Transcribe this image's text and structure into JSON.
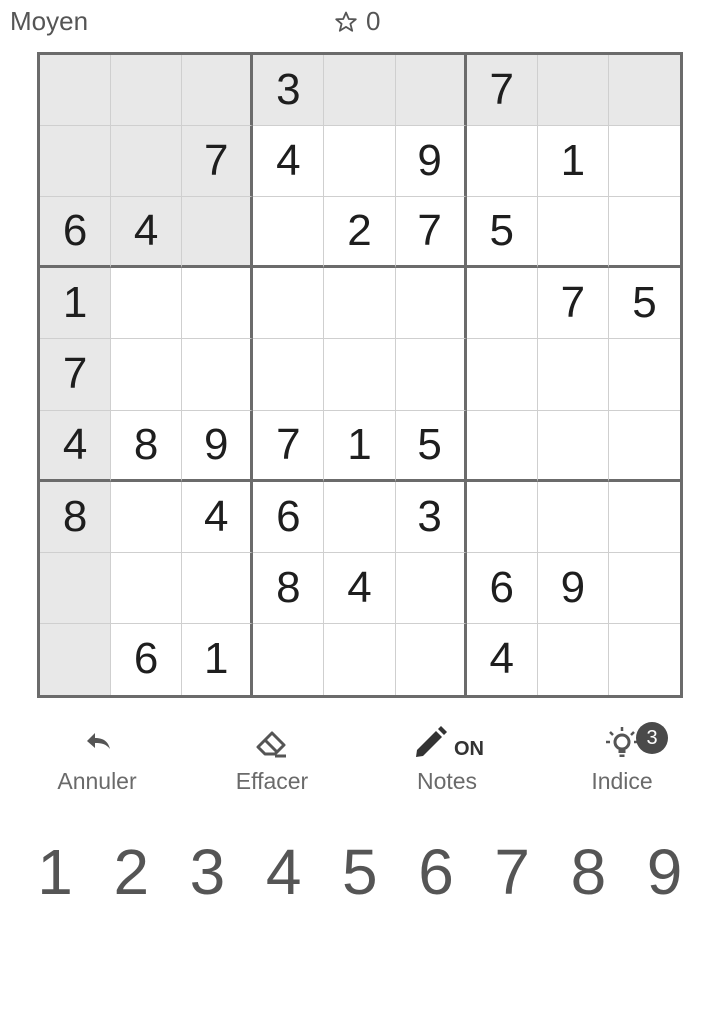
{
  "header": {
    "difficulty": "Moyen",
    "score": "0",
    "score_icon": "star-outline-icon"
  },
  "board": [
    [
      "",
      "",
      "",
      "3",
      "",
      "",
      "7",
      "",
      ""
    ],
    [
      "",
      "",
      "7",
      "4",
      "",
      "9",
      "",
      "1",
      ""
    ],
    [
      "6",
      "4",
      "",
      "",
      "2",
      "7",
      "5",
      "",
      ""
    ],
    [
      "1",
      "",
      "",
      "",
      "",
      "",
      "",
      "7",
      "5"
    ],
    [
      "7",
      "",
      "",
      "",
      "",
      "",
      "",
      "",
      ""
    ],
    [
      "4",
      "8",
      "9",
      "7",
      "1",
      "5",
      "",
      "",
      ""
    ],
    [
      "8",
      "",
      "4",
      "6",
      "",
      "3",
      "",
      "",
      ""
    ],
    [
      "",
      "",
      "",
      "8",
      "4",
      "",
      "6",
      "9",
      ""
    ],
    [
      "",
      "6",
      "1",
      "",
      "",
      "",
      "4",
      "",
      ""
    ]
  ],
  "highlighted": [
    [
      0,
      0
    ],
    [
      0,
      1
    ],
    [
      0,
      2
    ],
    [
      0,
      3
    ],
    [
      0,
      4
    ],
    [
      0,
      5
    ],
    [
      0,
      6
    ],
    [
      0,
      7
    ],
    [
      0,
      8
    ],
    [
      1,
      0
    ],
    [
      1,
      1
    ],
    [
      1,
      2
    ],
    [
      2,
      0
    ],
    [
      2,
      1
    ],
    [
      2,
      2
    ],
    [
      3,
      0
    ],
    [
      4,
      0
    ],
    [
      5,
      0
    ],
    [
      6,
      0
    ],
    [
      7,
      0
    ],
    [
      8,
      0
    ]
  ],
  "toolbar": {
    "undo_label": "Annuler",
    "erase_label": "Effacer",
    "notes_label": "Notes",
    "notes_state": "ON",
    "hint_label": "Indice",
    "hint_count": "3"
  },
  "numpad": [
    "1",
    "2",
    "3",
    "4",
    "5",
    "6",
    "7",
    "8",
    "9"
  ],
  "colors": {
    "highlight": "#e8e8e8",
    "thick_border": "#6b6b6b",
    "thin_border": "#cfcfcf"
  }
}
